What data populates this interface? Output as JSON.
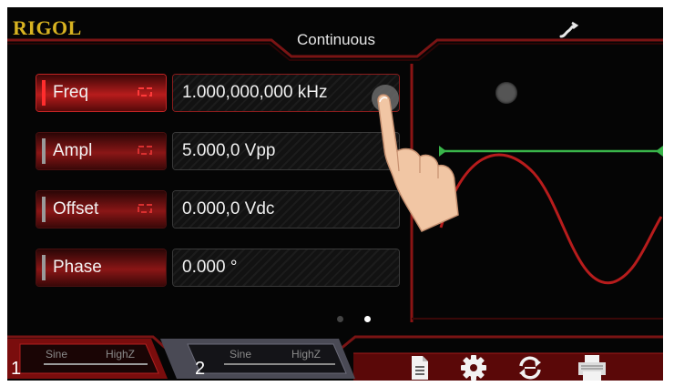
{
  "brand": "RIGOL",
  "mode": "Continuous",
  "colors": {
    "accent": "#c62828",
    "brand": "#d8b321",
    "waveform": "#b71c1c",
    "cursor": "#39b54a"
  },
  "params": [
    {
      "label": "Freq",
      "value": "1.000,000,000 kHz",
      "active": true
    },
    {
      "label": "Ampl",
      "value": "5.000,0 Vpp",
      "active": false
    },
    {
      "label": "Offset",
      "value": "0.000,0 Vdc",
      "active": false
    },
    {
      "label": "Phase",
      "value": "0.000 °",
      "active": false
    }
  ],
  "pager": {
    "pages": 2,
    "current": 2
  },
  "channels": [
    {
      "number": "1",
      "wave": "Sine",
      "load": "HighZ",
      "selected": true
    },
    {
      "number": "2",
      "wave": "Sine",
      "load": "HighZ",
      "selected": false
    }
  ],
  "bottom_icons": [
    "document-icon",
    "gear-icon",
    "sync-icon",
    "printer-icon"
  ],
  "top_icons": [
    "link-icon"
  ]
}
